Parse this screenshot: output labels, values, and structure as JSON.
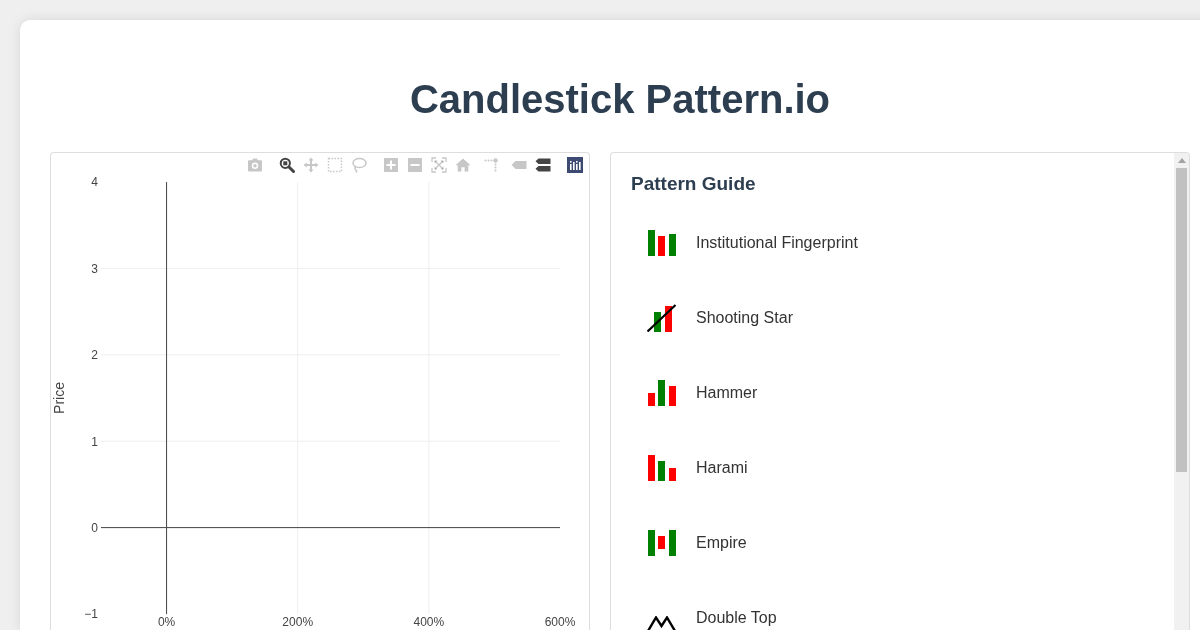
{
  "title": "Candlestick Pattern.io",
  "chart": {
    "modebar": [
      {
        "kind": "camera",
        "selected": false
      },
      {
        "kind": "zoom",
        "selected": true
      },
      {
        "kind": "pan",
        "selected": false
      },
      {
        "kind": "box_select",
        "selected": false
      },
      {
        "kind": "lasso",
        "selected": false
      },
      {
        "kind": "zoom_in",
        "selected": false
      },
      {
        "kind": "zoom_out",
        "selected": false
      },
      {
        "kind": "autoscale",
        "selected": false
      },
      {
        "kind": "reset",
        "selected": false
      },
      {
        "kind": "spikelines",
        "selected": false
      },
      {
        "kind": "hover_closest",
        "selected": false
      },
      {
        "kind": "hover_compare",
        "selected": true
      }
    ],
    "chart_data": {
      "type": "line",
      "ylabel": "Price",
      "xlim": [
        -100,
        600
      ],
      "ylim": [
        -1,
        4
      ],
      "xticks": [
        {
          "value": 0,
          "label": "0%"
        },
        {
          "value": 200,
          "label": "200%"
        },
        {
          "value": 400,
          "label": "400%"
        },
        {
          "value": 600,
          "label": "600%"
        }
      ],
      "yticks": [
        {
          "value": -1,
          "label": "−1"
        },
        0,
        1,
        2,
        3,
        4
      ],
      "grid": true
    }
  },
  "pattern_guide": {
    "heading": "Pattern Guide",
    "patterns": [
      {
        "kind": "fingerprint",
        "name": "Institutional Fingerprint"
      },
      {
        "kind": "shooting_star",
        "name": "Shooting Star"
      },
      {
        "kind": "hammer",
        "name": "Hammer"
      },
      {
        "kind": "harami",
        "name": "Harami"
      },
      {
        "kind": "empire",
        "name": "Empire"
      },
      {
        "kind": "double_top",
        "name": "Double Top"
      }
    ]
  }
}
